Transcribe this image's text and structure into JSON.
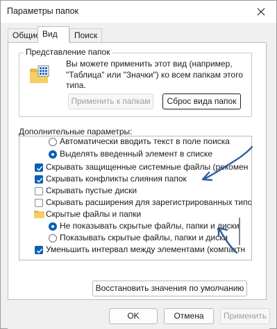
{
  "window": {
    "title": "Параметры папок"
  },
  "tabs": [
    {
      "label": "Общие",
      "active": false
    },
    {
      "label": "Вид",
      "active": true
    },
    {
      "label": "Поиск",
      "active": false
    }
  ],
  "folder_views": {
    "group_title": "Представление папок",
    "description": "Вы можете применить этот вид (например, \"Таблица\" или \"Значки\") ко всем папкам этого типа.",
    "apply_button": "Применить к папкам",
    "reset_button": "Сброс вида папок"
  },
  "advanced": {
    "label": "Дополнительные параметры:",
    "items": [
      {
        "type": "radio",
        "checked": false,
        "label": "Автоматически вводить текст в поле поиска"
      },
      {
        "type": "radio",
        "checked": true,
        "label": "Выделять введенный элемент в списке"
      },
      {
        "type": "checkbox",
        "checked": true,
        "label": "Скрывать защищенные системные файлы (рекомен"
      },
      {
        "type": "checkbox",
        "checked": true,
        "label": "Скрывать конфликты слияния папок"
      },
      {
        "type": "checkbox",
        "checked": false,
        "label": "Скрывать пустые диски"
      },
      {
        "type": "checkbox",
        "checked": false,
        "label": "Скрывать расширения для зарегистрированных типо"
      },
      {
        "type": "folder",
        "label": "Скрытые файлы и папки"
      },
      {
        "type": "radio",
        "checked": true,
        "label": "Не показывать скрытые файлы, папки и диски"
      },
      {
        "type": "radio",
        "checked": false,
        "label": "Показывать скрытые файлы, папки и диски"
      },
      {
        "type": "checkbox",
        "checked": true,
        "label": "Уменьшить интервал между элементами (компактн"
      }
    ]
  },
  "restore_button": "Восстановить значения по умолчанию",
  "footer": {
    "ok": "OK",
    "cancel": "Отмена",
    "apply": "Применить"
  },
  "colors": {
    "accent": "#0a5fb4",
    "annotation": "#2f5e9e"
  }
}
